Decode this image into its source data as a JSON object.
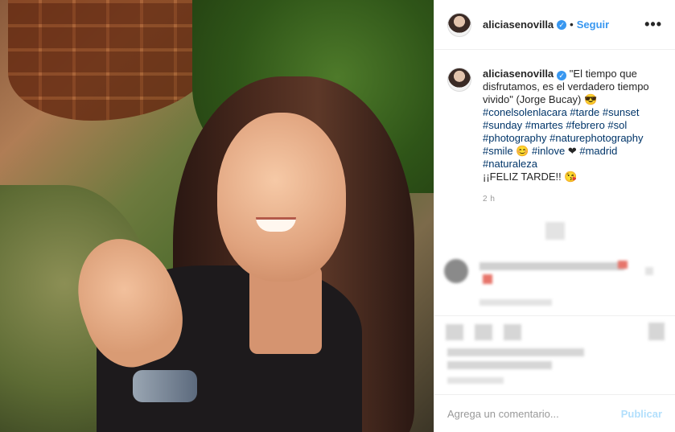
{
  "post": {
    "username": "aliciasenovilla",
    "verified_symbol": "✓",
    "separator": "•",
    "follow_label": "Seguir",
    "more_label": "•••"
  },
  "caption": {
    "username": "aliciasenovilla",
    "text": "\"El tiempo que disfrutamos, es el verdadero tiempo vivido\" (Jorge Bucay) 😎",
    "tags_line1": [
      "#conelsolenlacara",
      "#tarde"
    ],
    "tags_line2": [
      "#sunset",
      "#sunday",
      "#martes",
      "#febrero"
    ],
    "tags_line3": [
      "#sol",
      "#photography"
    ],
    "tags_line4": [
      "#naturephotography",
      "#smile"
    ],
    "tags_line5": [
      "#inlove",
      "#madrid",
      "#naturaleza"
    ],
    "emoji_smile": "😊",
    "emoji_heart": "❤",
    "closing": "¡¡FELIZ TARDE!!",
    "closing_emoji": "😘",
    "time": "2 h"
  },
  "comment_bar": {
    "placeholder": "Agrega un comentario...",
    "publish_label": "Publicar"
  }
}
